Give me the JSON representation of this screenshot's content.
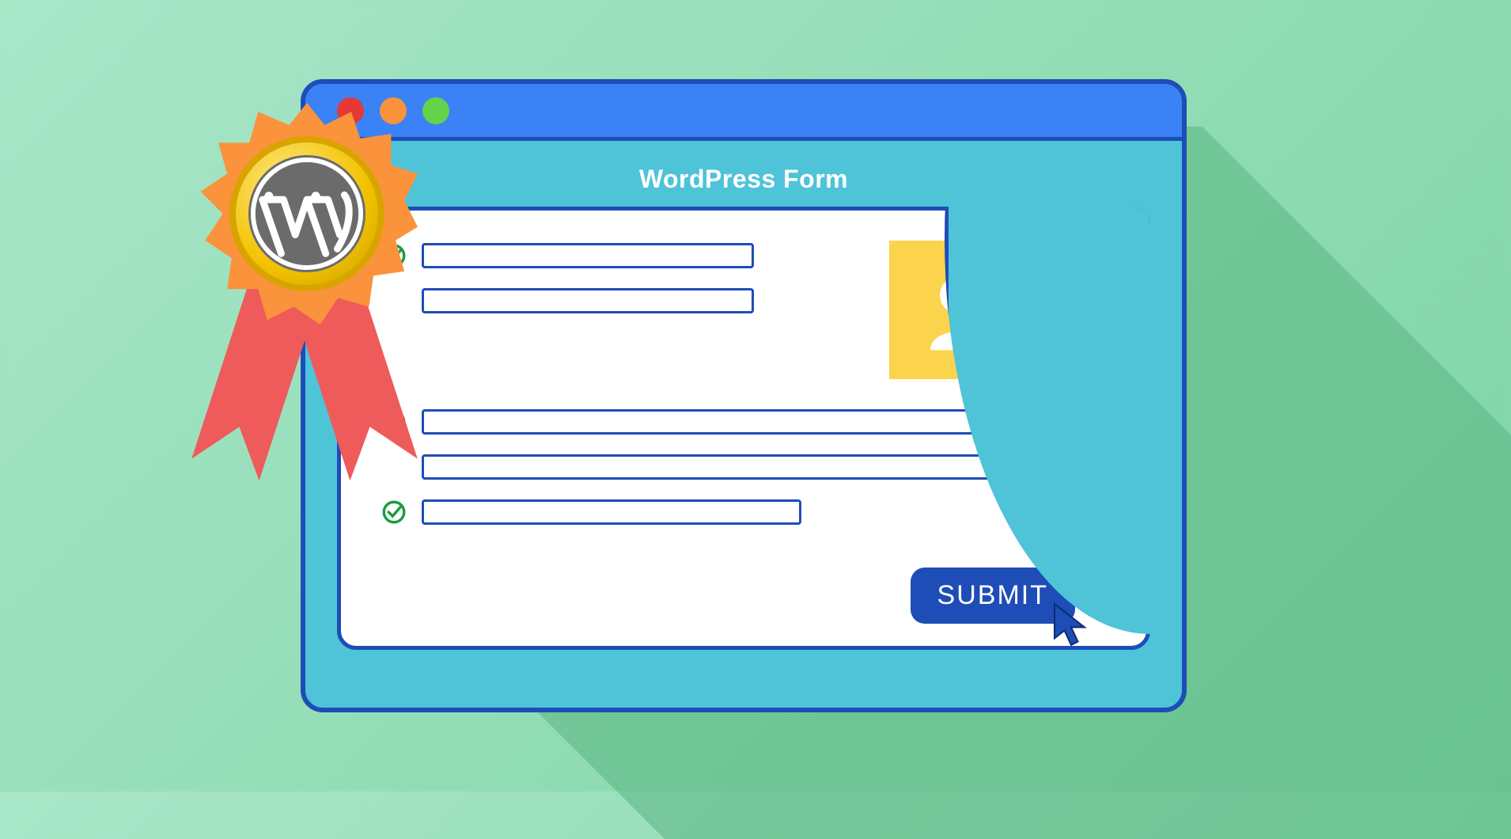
{
  "form": {
    "title": "WordPress Form",
    "submit_label": "SUBMIT"
  },
  "colors": {
    "accent endif": "#1e4db7"
  }
}
